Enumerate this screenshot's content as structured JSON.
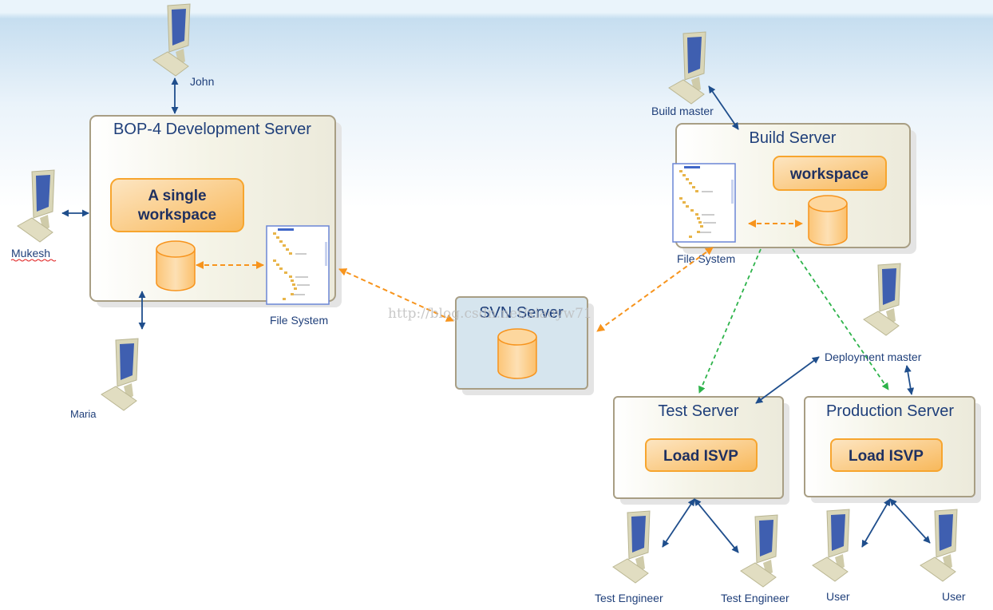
{
  "servers": {
    "dev": {
      "title": "BOP-4 Development Server",
      "workspace": "A single workspace",
      "workspace_line1": "A single",
      "workspace_line2": "workspace",
      "file_system": "File System"
    },
    "svn": {
      "title": "SVN Server"
    },
    "build": {
      "title": "Build Server",
      "workspace": "workspace",
      "file_system": "File System"
    },
    "test": {
      "title": "Test Server",
      "action": "Load ISVP"
    },
    "production": {
      "title": "Production Server",
      "action": "Load ISVP"
    }
  },
  "users": {
    "john": "John",
    "mukesh": "Mukesh",
    "maria": "Maria",
    "build_master": "Build master",
    "deployment_master": "Deployment master",
    "test_engineer_1": "Test Engineer",
    "test_engineer_2": "Test Engineer",
    "user_1": "User",
    "user_2": "User"
  },
  "watermark": "http://blog.csdn.net/xiaoyw71",
  "colors": {
    "user_link": "#1f4e8c",
    "sync_link": "#f7941d",
    "deploy_link": "#2db34a",
    "server_fill": "#efeedc",
    "svn_fill": "#d6e5ee",
    "workspace_fill": "#fbcf8e"
  },
  "icons": {
    "client": "computer-icon",
    "storage": "database-icon",
    "tree": "file-tree-icon"
  }
}
